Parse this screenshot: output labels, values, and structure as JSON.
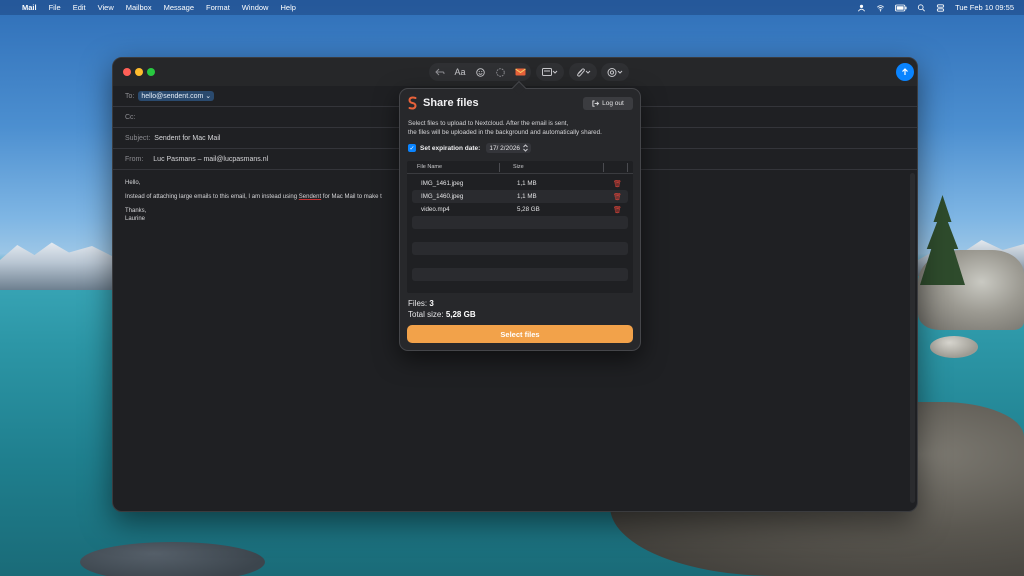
{
  "menubar": {
    "app": "Mail",
    "items": [
      "File",
      "Edit",
      "View",
      "Mailbox",
      "Message",
      "Format",
      "Window",
      "Help"
    ],
    "clock": "Tue Feb 10  09:55"
  },
  "compose": {
    "to_label": "To:",
    "to_value": "hello@sendent.com",
    "cc_label": "Cc:",
    "subject_label": "Subject:",
    "subject_value": "Sendent for Mac Mail",
    "from_label": "From:",
    "from_value": "Luc Pasmans – mail@lucpasmans.nl",
    "body_greeting": "Hello,",
    "body_line_pre": "Instead of attaching large emails to this email, I am instead using ",
    "body_line_link": "Sendent",
    "body_line_post": " for Mac Mail to make t",
    "body_thanks": "Thanks,",
    "body_signature": "Laurine"
  },
  "toolbar": {
    "format_label": "Aa"
  },
  "share": {
    "title": "Share files",
    "logout_label": "Log out",
    "description_line1": "Select files to upload to Nextcloud. After the email is sent,",
    "description_line2": "the files will be uploaded in the background and automatically shared.",
    "expiration_label": "Set expiration date:",
    "expiration_date": "17/  2/2026",
    "expiration_checked": true,
    "columns": [
      "File Name",
      "Size"
    ],
    "files": [
      {
        "name": "IMG_1461.jpeg",
        "size": "1,1 MB"
      },
      {
        "name": "IMG_1460.jpeg",
        "size": "1,1 MB"
      },
      {
        "name": "video.mp4",
        "size": "5,28 GB"
      }
    ],
    "files_label": "Files:",
    "files_count": "3",
    "total_label": "Total size:",
    "total_size": "5,28 GB",
    "select_button": "Select files"
  },
  "colors": {
    "accent_orange": "#f2a24a",
    "accent_blue": "#0a84ff",
    "delete_red": "#e0443a"
  }
}
